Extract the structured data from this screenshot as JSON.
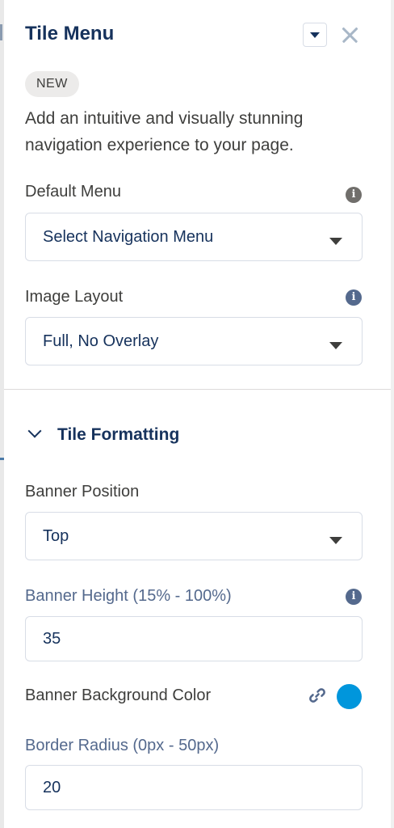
{
  "panel": {
    "title": "Tile Menu",
    "badge": "NEW",
    "description": "Add an intuitive and visually stunning navigation experience to your page."
  },
  "icons": {
    "dropdown": "chevron-down-icon",
    "close": "close-icon",
    "info": "info-icon",
    "link": "link-icon",
    "expand": "chevron-down-icon"
  },
  "fields": {
    "default_menu": {
      "label": "Default Menu",
      "value": "Select Navigation Menu"
    },
    "image_layout": {
      "label": "Image Layout",
      "value": "Full, No Overlay"
    }
  },
  "tile_formatting": {
    "section_label": "Tile Formatting",
    "banner_position": {
      "label": "Banner Position",
      "value": "Top"
    },
    "banner_height": {
      "label": "Banner Height (15% - 100%)",
      "value": "35"
    },
    "banner_background_color": {
      "label": "Banner Background Color",
      "color": "#0096dc"
    },
    "border_radius": {
      "label": "Border Radius (0px - 50px)",
      "value": "20"
    }
  },
  "colors": {
    "title": "#16325c",
    "label_accent": "#54698d",
    "swatch": "#0096dc"
  }
}
